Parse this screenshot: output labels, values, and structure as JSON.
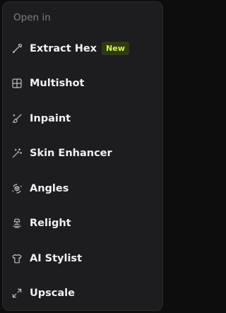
{
  "menu": {
    "header": "Open in",
    "items": [
      {
        "label": "Extract Hex",
        "icon": "eyedropper-icon",
        "badge": "New"
      },
      {
        "label": "Multishot",
        "icon": "grid-icon"
      },
      {
        "label": "Inpaint",
        "icon": "brush-icon"
      },
      {
        "label": "Skin Enhancer",
        "icon": "magic-wand-icon"
      },
      {
        "label": "Angles",
        "icon": "cube-rotate-icon"
      },
      {
        "label": "Relight",
        "icon": "lamp-icon"
      },
      {
        "label": "AI Stylist",
        "icon": "shirt-icon"
      },
      {
        "label": "Upscale",
        "icon": "expand-icon"
      }
    ]
  },
  "colors": {
    "background": "#1d1d1f",
    "text": "#f1f1f3",
    "muted": "#808086",
    "icon": "#bdbdc2",
    "badge_bg": "#2f3a10",
    "badge_text": "#d4f542"
  }
}
